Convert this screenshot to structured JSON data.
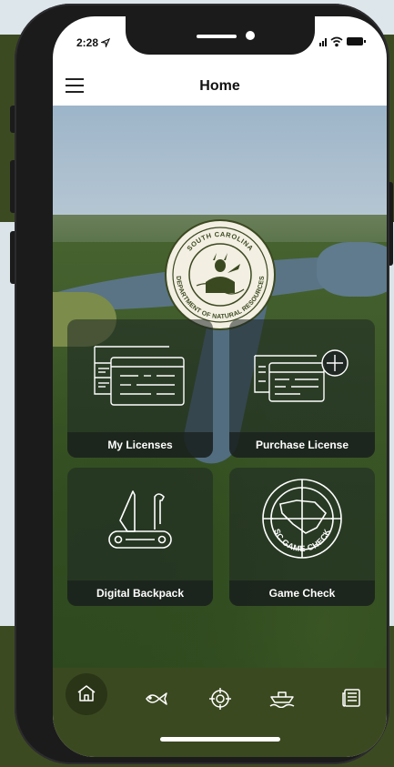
{
  "status": {
    "time": "2:28"
  },
  "header": {
    "title": "Home"
  },
  "seal": {
    "top_text": "SOUTH CAROLINA",
    "bottom_text": "DEPARTMENT OF NATURAL RESOURCES"
  },
  "tiles": [
    {
      "label": "My Licenses",
      "icon": "license-cards-icon"
    },
    {
      "label": "Purchase License",
      "icon": "license-add-icon"
    },
    {
      "label": "Digital Backpack",
      "icon": "pocket-knife-icon"
    },
    {
      "label": "Game Check",
      "icon": "sc-game-check-icon",
      "badge_text": "SC GAME CHECK"
    }
  ],
  "tabbar": {
    "items": [
      "home-icon",
      "fish-icon",
      "target-icon",
      "boat-icon",
      "newspaper-icon"
    ]
  },
  "colors": {
    "accent": "#3b4920",
    "tile_bg": "#1e2624"
  }
}
